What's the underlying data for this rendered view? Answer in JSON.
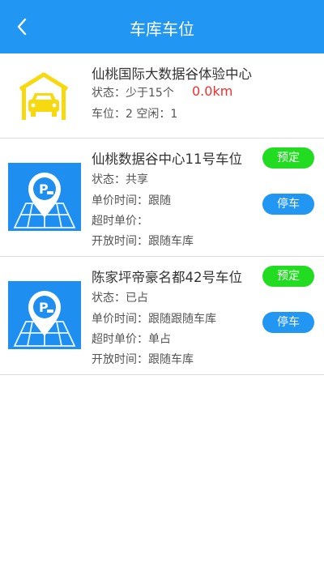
{
  "header": {
    "title": "车库车位",
    "back_icon": "chevron-left-icon"
  },
  "garage": {
    "name": "仙桃国际大数据谷体验中心",
    "status_label": "状态：",
    "status_value": "少于15个",
    "distance": "0.0km",
    "spaces_text": "车位：2 空闲：1",
    "icon": "garage-car-icon"
  },
  "spots": [
    {
      "name": "仙桃数据谷中心11号车位",
      "status": "状态：共享",
      "unit_price": "单价时间：跟随",
      "overtime_price": "超时单价：",
      "open_time": "开放时间：跟随车库",
      "book_label": "预定",
      "park_label": "停车",
      "icon": "parking-location-icon"
    },
    {
      "name": "陈家坪帝豪名都42号车位",
      "status": "状态：已占",
      "unit_price": "单价时间：跟随跟随车库",
      "overtime_price": "超时单价：单占",
      "open_time": "开放时间：跟随车库",
      "book_label": "预定",
      "park_label": "停车",
      "icon": "parking-location-icon"
    }
  ],
  "colors": {
    "header_bg": "#2196f3",
    "book_button": "#22dc22",
    "park_button": "#2196f3",
    "distance": "#f0302c",
    "garage_icon": "#f7d90f"
  }
}
